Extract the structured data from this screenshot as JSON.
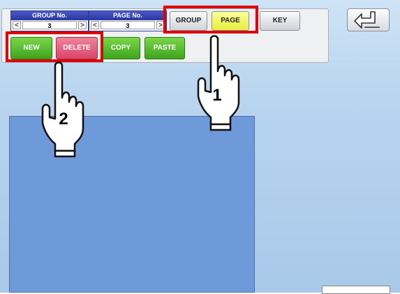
{
  "group_stepper": {
    "label": "GROUP No.",
    "value": "3",
    "prev": "<",
    "next": ">"
  },
  "page_stepper": {
    "label": "PAGE No.",
    "value": "3",
    "prev": "<",
    "next": ">"
  },
  "mode_tabs": [
    {
      "label": "GROUP",
      "selected": false
    },
    {
      "label": "PAGE",
      "selected": true
    },
    {
      "label": "KEY",
      "selected": false
    }
  ],
  "actions": {
    "new": "NEW",
    "delete": "DELETE",
    "copy": "COPY",
    "paste": "PASTE"
  },
  "back_button": {
    "icon": "return-arrow-icon"
  },
  "callouts": {
    "step1": "1",
    "step2": "2"
  },
  "colors": {
    "highlight": "#e0000a",
    "selected_tab": "#e6ee3a",
    "action_green": "#3ea41c",
    "action_red": "#d84668",
    "panel": "#6f9ad9"
  }
}
